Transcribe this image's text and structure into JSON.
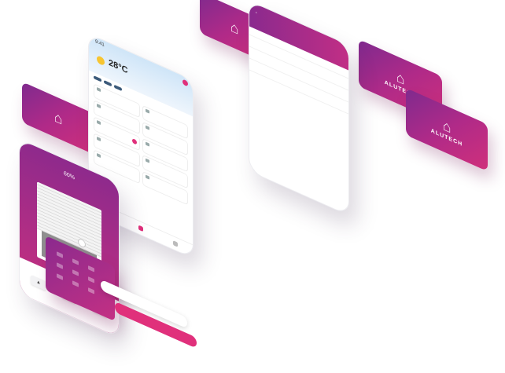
{
  "brand": {
    "name": "ALUTECH",
    "accent": "#e0307b",
    "gradient_start": "#7e2a8e",
    "gradient_end": "#d0307b"
  },
  "center_phone": {
    "time": "9:41",
    "temperature": "28°C",
    "weather_icon": "sun-icon",
    "chips": [
      "",
      "",
      ""
    ],
    "section_title": "",
    "devices": [
      "",
      "",
      "",
      "",
      "",
      "",
      "",
      "",
      "",
      ""
    ]
  },
  "right_phone": {
    "title": "",
    "subtitle": "",
    "rows": [
      {
        "date": "",
        "line1": "",
        "line2": ""
      },
      {
        "date": "",
        "line1": "",
        "line2": ""
      },
      {
        "date": "",
        "line1": "",
        "line2": ""
      }
    ]
  },
  "left_phone": {
    "title": "",
    "percent": "60%",
    "buttons": {
      "up": "▲",
      "stop": "■",
      "down": "▼"
    }
  },
  "login": {
    "primary": "",
    "secondary": ""
  }
}
